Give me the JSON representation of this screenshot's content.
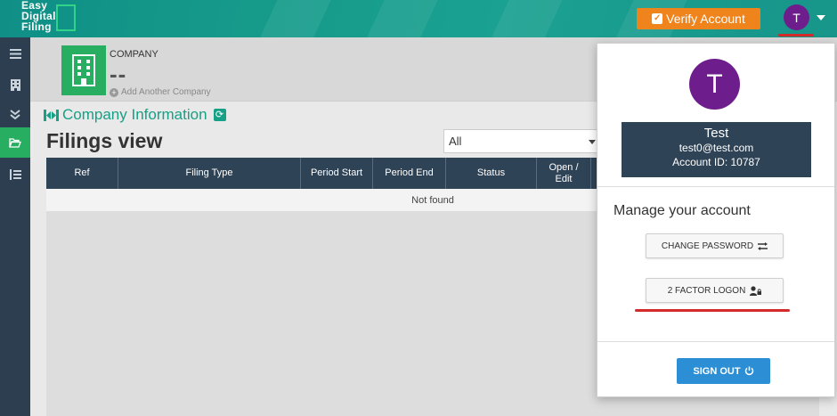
{
  "brand": {
    "logo_text": "Easy\nDigital\nFiling"
  },
  "topbar": {
    "verify_button": "Verify Account",
    "user_initial": "T"
  },
  "sidebar": {
    "items": [
      {
        "icon": "menu-icon"
      },
      {
        "icon": "building-icon"
      },
      {
        "icon": "double-chevron-down-icon"
      },
      {
        "icon": "folder-open-icon",
        "active": true
      },
      {
        "icon": "list-icon"
      }
    ]
  },
  "company": {
    "label": "COMPANY",
    "name": "--",
    "add_link": "Add Another Company"
  },
  "section": {
    "title": "Company Information"
  },
  "page": {
    "title": "Filings view"
  },
  "filter": {
    "selected": "All"
  },
  "table": {
    "columns": [
      "Ref",
      "Filing Type",
      "Period Start",
      "Period End",
      "Status",
      "Open / Edit"
    ],
    "empty_message": "Not found"
  },
  "account_menu": {
    "avatar_initial": "T",
    "user_name": "Test",
    "user_email": "test0@test.com",
    "account_id": "Account ID: 10787",
    "manage_title": "Manage your account",
    "change_password": "CHANGE PASSWORD",
    "two_factor": "2 FACTOR LOGON",
    "sign_out": "SIGN OUT"
  },
  "colors": {
    "topbar": "#17958a",
    "sidebar": "#2c3e50",
    "accent_green": "#27ae60",
    "verify_orange": "#f0841c",
    "avatar_purple": "#6e1e8c",
    "table_header": "#2f4356",
    "signout_blue": "#2c8fd6",
    "highlight_red": "#d42a2a"
  }
}
